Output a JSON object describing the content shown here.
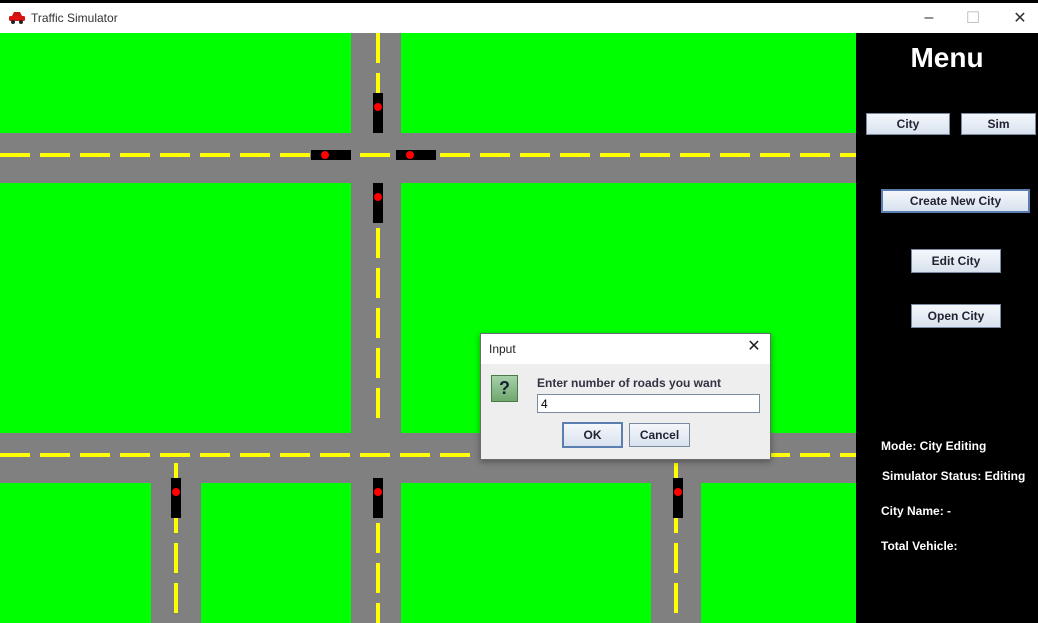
{
  "window": {
    "title": "Traffic Simulator",
    "icon": "red-car-icon",
    "controls": {
      "minimize": "–",
      "maximize": "☐",
      "close": "✕"
    }
  },
  "canvas": {
    "grass_color": "#00ff00",
    "road_color": "#808080",
    "lane_marking_color": "#ffff00",
    "signal_light_color": "#ff0000"
  },
  "menu": {
    "title": "Menu",
    "top_buttons": [
      {
        "label": "City"
      },
      {
        "label": "Sim"
      }
    ],
    "actions": [
      {
        "label": "Create New City"
      },
      {
        "label": "Edit City"
      },
      {
        "label": "Open City"
      }
    ],
    "status": {
      "mode": "Mode: City Editing",
      "simulator_status": "Simulator Status: Editing",
      "city_name": "City Name: -",
      "total_vehicle": "Total Vehicle:"
    }
  },
  "dialog": {
    "title": "Input",
    "icon": "question-icon",
    "message": "Enter number of roads you want",
    "input_value": "4",
    "ok_label": "OK",
    "cancel_label": "Cancel"
  }
}
